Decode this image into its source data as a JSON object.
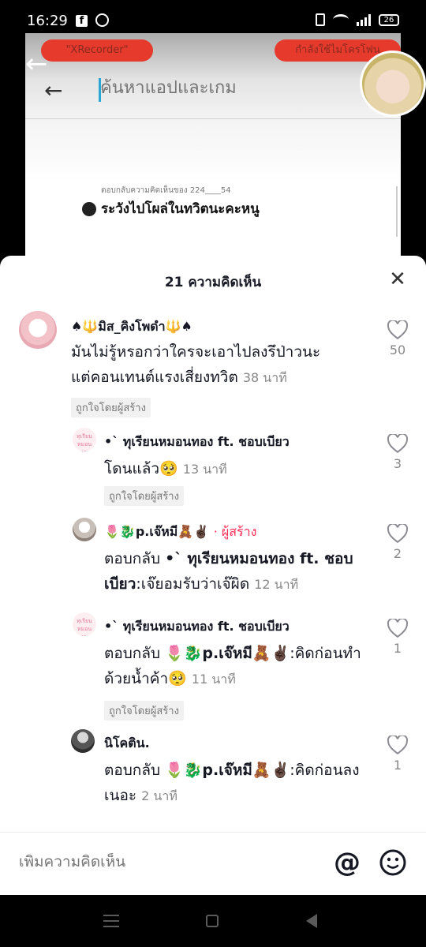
{
  "status_bar": {
    "time": "16:29",
    "battery": "26"
  },
  "background_app": {
    "recorder_left": "\"XRecorder\"",
    "recorder_right": "กำลังใช้ไมโครโฟน",
    "search_placeholder": "ค้นหาแอปและเกม",
    "reply_sub": "ตอบกลับความคิดเห็นของ 224____54",
    "reply_main": "ระวังไปโผล่ในทวิตนะคะหนู"
  },
  "sheet": {
    "title": "21 ความคิดเห็น",
    "comments": [
      {
        "username": "♠🔱มิส_คิงโพดำ🔱♠",
        "text": "มันไม่รู้หรอกว่าใครจะเอาไปลงรึป่าวนะแต่คอนเทนต์แรงเสี่ยงทวิต",
        "time": "38 นาที",
        "liked_by": "ถูกใจโดยผู้สร้าง",
        "likes": "50"
      },
      {
        "username": "•` ทุเรียนหมอนทอง ft. ชอบเบียว",
        "avatar_text": "ทุเรียน หมอนทอง",
        "text": "โดนแล้ว🥺",
        "time": "13 นาที",
        "liked_by": "ถูกใจโดยผู้สร้าง",
        "likes": "3"
      },
      {
        "username": "🌷🐉p.เจ๊หมี🧸✌🏿",
        "creator_label": "· ผู้สร้าง",
        "reply_prefix": "ตอบกลับ",
        "reply_to": "•` ทุเรียนหมอนทอง ft. ชอบเบียว",
        "text": ":เจ๊ยอมรับว่าเจ๊ผิด",
        "time": "12 นาที",
        "likes": "2"
      },
      {
        "username": "•` ทุเรียนหมอนทอง ft. ชอบเบียว",
        "avatar_text": "ทุเรียน หมอนทอง",
        "reply_prefix": "ตอบกลับ",
        "reply_to": "🌷🐉p.เจ๊หมี🧸✌🏿",
        "text": ":คิดก่อนทำด้วยน้ำค้า🥺",
        "time": "11 นาที",
        "liked_by": "ถูกใจโดยผู้สร้าง",
        "likes": "1"
      },
      {
        "username": "นิโคติน.",
        "reply_prefix": "ตอบกลับ",
        "reply_to": "🌷🐉p.เจ๊หมี🧸✌🏿",
        "text": ":คิดก่อนลงเนอะ",
        "time": "2 นาที",
        "likes": "1"
      }
    ]
  },
  "input_bar": {
    "placeholder": "เพิ่มความคิดเห็น",
    "at_symbol": "@"
  },
  "colors": {
    "accent": "#fe2c55",
    "recorder_pill": "#e53a2c",
    "text": "#161823"
  }
}
